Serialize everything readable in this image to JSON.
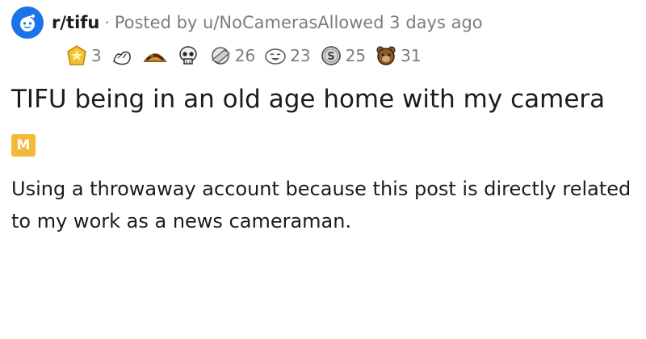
{
  "header": {
    "subreddit": "r/tifu",
    "separator": "·",
    "posted_by": "Posted by u/NoCamerasAllowed 3 days ago"
  },
  "awards": [
    {
      "icon": "gold-star-award-icon",
      "count": "3"
    },
    {
      "icon": "hands-award-icon",
      "count": ""
    },
    {
      "icon": "taco-award-icon",
      "count": ""
    },
    {
      "icon": "skull-award-icon",
      "count": ""
    },
    {
      "icon": "facepalm-award-icon",
      "count": "26"
    },
    {
      "icon": "laughing-face-award-icon",
      "count": "23"
    },
    {
      "icon": "silver-coin-award-icon",
      "count": "25"
    },
    {
      "icon": "bear-award-icon",
      "count": "31"
    }
  ],
  "post": {
    "title": "TIFU being in an old age home with my camera",
    "flair": "M",
    "body": "Using a throwaway account because this post is directly related to my work as a news cameraman."
  },
  "colors": {
    "subreddit_avatar": "#1a73e8",
    "flair": "#f5b93a",
    "meta_text": "#7c7c7c"
  }
}
